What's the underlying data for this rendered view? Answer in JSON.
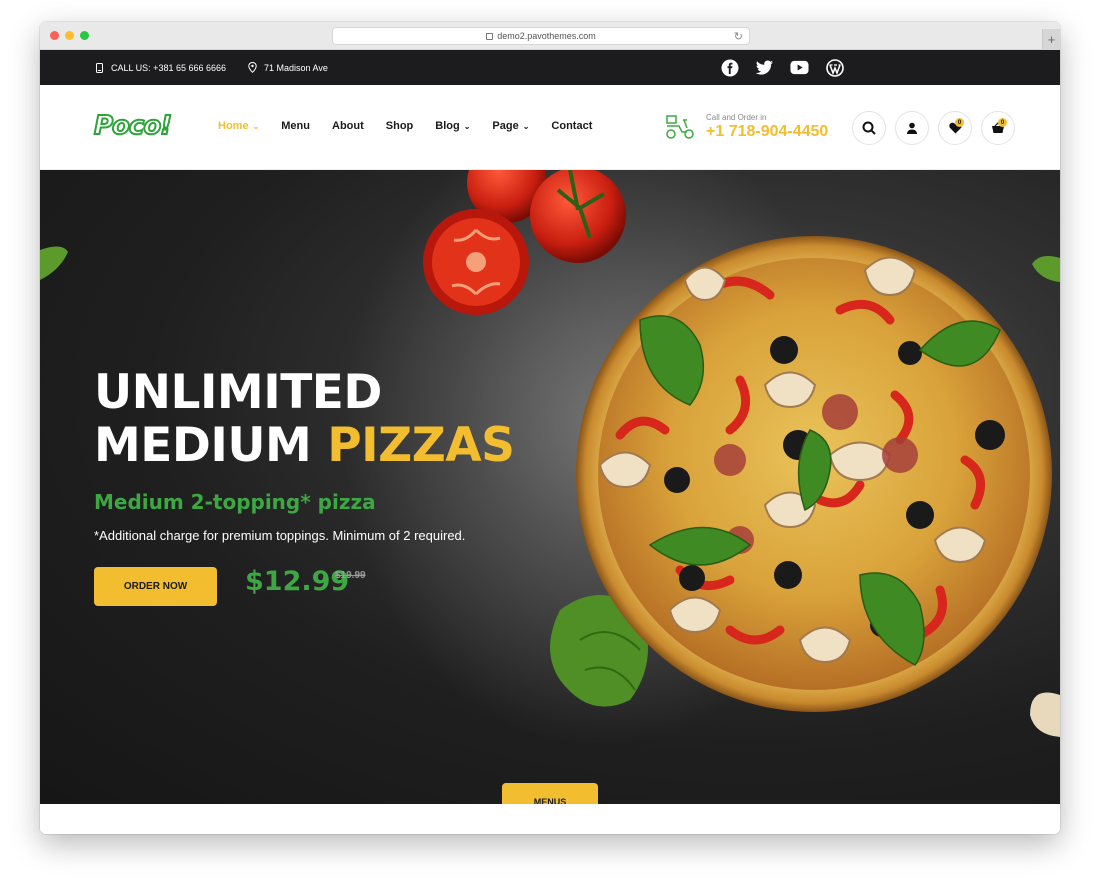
{
  "browser": {
    "url": "demo2.pavothemes.com"
  },
  "topbar": {
    "phone_label": "CALL US: +381 65 666 6666",
    "address": "71 Madison Ave",
    "socials": [
      "facebook-icon",
      "twitter-icon",
      "youtube-icon",
      "wordpress-icon"
    ]
  },
  "header": {
    "logo": "Poco!",
    "nav": [
      {
        "label": "Home",
        "dropdown": true,
        "active": true
      },
      {
        "label": "Menu",
        "dropdown": false
      },
      {
        "label": "About",
        "dropdown": false
      },
      {
        "label": "Shop",
        "dropdown": false
      },
      {
        "label": "Blog",
        "dropdown": true
      },
      {
        "label": "Page",
        "dropdown": true
      },
      {
        "label": "Contact",
        "dropdown": false
      }
    ],
    "call_label": "Call and Order in",
    "call_phone": "+1 718-904-4450",
    "wishlist_count": "0",
    "cart_count": "0"
  },
  "hero": {
    "title_line1": "UNLIMITED",
    "title_line2_white": "MEDIUM",
    "title_line2_yellow": "PIZZAS",
    "subtitle": "Medium 2-topping* pizza",
    "note": "*Additional charge for premium toppings. Minimum of 2 required.",
    "order_button": "ORDER NOW",
    "price": "$12.99",
    "old_price": "$19.99",
    "menus_button": "MENUS"
  },
  "colors": {
    "accent": "#f2bd2e",
    "green": "#3da843",
    "topbar_bg": "#1c1c1f"
  }
}
